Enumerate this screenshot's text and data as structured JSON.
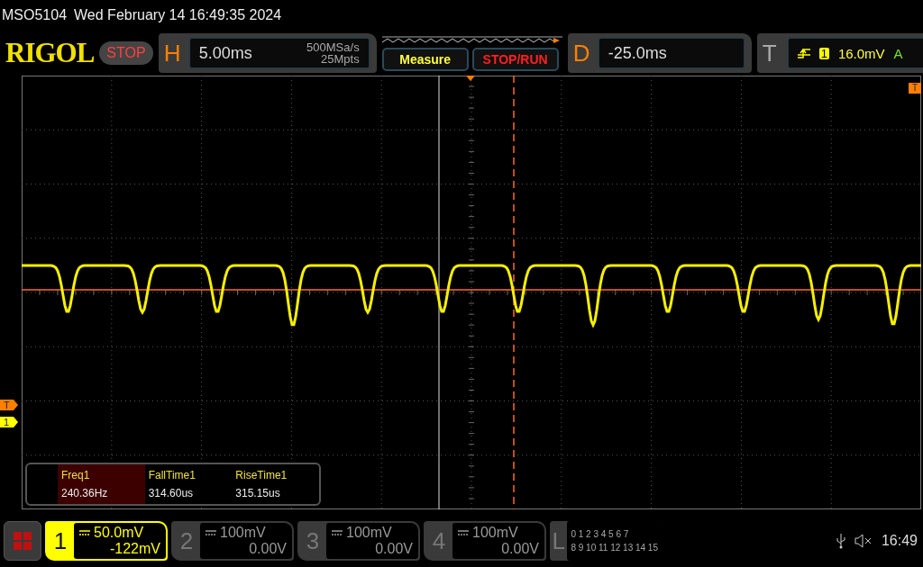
{
  "status_line": {
    "model": "MSO5104",
    "datetime": "Wed February 14 16:49:35 2024"
  },
  "brand": "RIGOL",
  "run_state": {
    "label": "STOP",
    "stopped": true
  },
  "horizontal": {
    "letter": "H",
    "timebase": "5.00ms",
    "sample_rate": "500MSa/s",
    "memory_depth": "25Mpts"
  },
  "buttons": [
    {
      "label": "Measure",
      "kind": "measure"
    },
    {
      "label": "STOP/RUN",
      "kind": "stoprun"
    }
  ],
  "delay": {
    "letter": "D",
    "value": "-25.0ms"
  },
  "trigger": {
    "letter": "T",
    "source": "1",
    "level": "16.0mV",
    "mode": "A"
  },
  "left_markers": [
    {
      "label": "T",
      "color": "#ff8000"
    },
    {
      "label": "1",
      "color": "#ffff00"
    }
  ],
  "right_marker": {
    "label": "T"
  },
  "measurements": [
    {
      "name": "Freq1",
      "value": "240.36Hz",
      "selected": true
    },
    {
      "name": "FallTime1",
      "value": "314.60us",
      "selected": false
    },
    {
      "name": "RiseTime1",
      "value": "315.15us",
      "selected": false
    }
  ],
  "channels": [
    {
      "number": "1",
      "scale": "50.0mV",
      "offset": "-122mV",
      "selected": true
    },
    {
      "number": "2",
      "scale": "100mV",
      "offset": "0.00V",
      "selected": false
    },
    {
      "number": "3",
      "scale": "100mV",
      "offset": "0.00V",
      "selected": false
    },
    {
      "number": "4",
      "scale": "100mV",
      "offset": "0.00V",
      "selected": false
    }
  ],
  "logic": {
    "letter": "L",
    "row_1": "0 1 2 3 4 5 6 7",
    "row_2": "8 9 10 11 12 13 14 15"
  },
  "clock": "16:49"
}
